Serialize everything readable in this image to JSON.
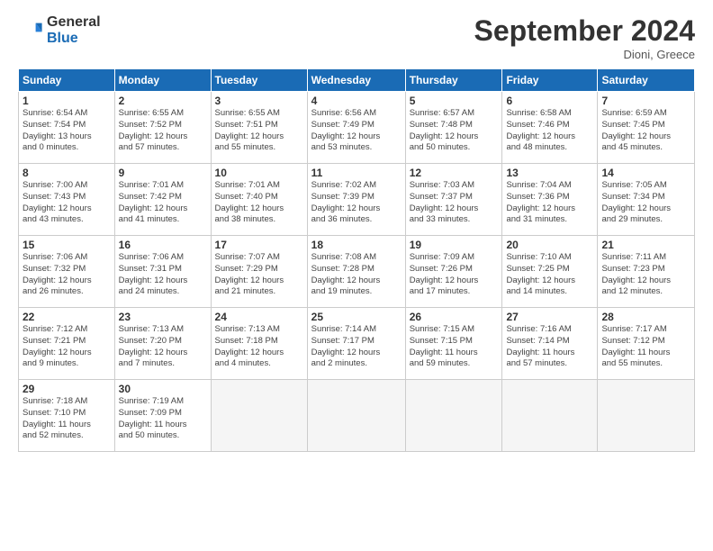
{
  "header": {
    "logo_general": "General",
    "logo_blue": "Blue",
    "title": "September 2024",
    "location": "Dioni, Greece"
  },
  "days_of_week": [
    "Sunday",
    "Monday",
    "Tuesday",
    "Wednesday",
    "Thursday",
    "Friday",
    "Saturday"
  ],
  "weeks": [
    [
      {
        "day": "1",
        "info": "Sunrise: 6:54 AM\nSunset: 7:54 PM\nDaylight: 13 hours\nand 0 minutes."
      },
      {
        "day": "2",
        "info": "Sunrise: 6:55 AM\nSunset: 7:52 PM\nDaylight: 12 hours\nand 57 minutes."
      },
      {
        "day": "3",
        "info": "Sunrise: 6:55 AM\nSunset: 7:51 PM\nDaylight: 12 hours\nand 55 minutes."
      },
      {
        "day": "4",
        "info": "Sunrise: 6:56 AM\nSunset: 7:49 PM\nDaylight: 12 hours\nand 53 minutes."
      },
      {
        "day": "5",
        "info": "Sunrise: 6:57 AM\nSunset: 7:48 PM\nDaylight: 12 hours\nand 50 minutes."
      },
      {
        "day": "6",
        "info": "Sunrise: 6:58 AM\nSunset: 7:46 PM\nDaylight: 12 hours\nand 48 minutes."
      },
      {
        "day": "7",
        "info": "Sunrise: 6:59 AM\nSunset: 7:45 PM\nDaylight: 12 hours\nand 45 minutes."
      }
    ],
    [
      {
        "day": "8",
        "info": "Sunrise: 7:00 AM\nSunset: 7:43 PM\nDaylight: 12 hours\nand 43 minutes."
      },
      {
        "day": "9",
        "info": "Sunrise: 7:01 AM\nSunset: 7:42 PM\nDaylight: 12 hours\nand 41 minutes."
      },
      {
        "day": "10",
        "info": "Sunrise: 7:01 AM\nSunset: 7:40 PM\nDaylight: 12 hours\nand 38 minutes."
      },
      {
        "day": "11",
        "info": "Sunrise: 7:02 AM\nSunset: 7:39 PM\nDaylight: 12 hours\nand 36 minutes."
      },
      {
        "day": "12",
        "info": "Sunrise: 7:03 AM\nSunset: 7:37 PM\nDaylight: 12 hours\nand 33 minutes."
      },
      {
        "day": "13",
        "info": "Sunrise: 7:04 AM\nSunset: 7:36 PM\nDaylight: 12 hours\nand 31 minutes."
      },
      {
        "day": "14",
        "info": "Sunrise: 7:05 AM\nSunset: 7:34 PM\nDaylight: 12 hours\nand 29 minutes."
      }
    ],
    [
      {
        "day": "15",
        "info": "Sunrise: 7:06 AM\nSunset: 7:32 PM\nDaylight: 12 hours\nand 26 minutes."
      },
      {
        "day": "16",
        "info": "Sunrise: 7:06 AM\nSunset: 7:31 PM\nDaylight: 12 hours\nand 24 minutes."
      },
      {
        "day": "17",
        "info": "Sunrise: 7:07 AM\nSunset: 7:29 PM\nDaylight: 12 hours\nand 21 minutes."
      },
      {
        "day": "18",
        "info": "Sunrise: 7:08 AM\nSunset: 7:28 PM\nDaylight: 12 hours\nand 19 minutes."
      },
      {
        "day": "19",
        "info": "Sunrise: 7:09 AM\nSunset: 7:26 PM\nDaylight: 12 hours\nand 17 minutes."
      },
      {
        "day": "20",
        "info": "Sunrise: 7:10 AM\nSunset: 7:25 PM\nDaylight: 12 hours\nand 14 minutes."
      },
      {
        "day": "21",
        "info": "Sunrise: 7:11 AM\nSunset: 7:23 PM\nDaylight: 12 hours\nand 12 minutes."
      }
    ],
    [
      {
        "day": "22",
        "info": "Sunrise: 7:12 AM\nSunset: 7:21 PM\nDaylight: 12 hours\nand 9 minutes."
      },
      {
        "day": "23",
        "info": "Sunrise: 7:13 AM\nSunset: 7:20 PM\nDaylight: 12 hours\nand 7 minutes."
      },
      {
        "day": "24",
        "info": "Sunrise: 7:13 AM\nSunset: 7:18 PM\nDaylight: 12 hours\nand 4 minutes."
      },
      {
        "day": "25",
        "info": "Sunrise: 7:14 AM\nSunset: 7:17 PM\nDaylight: 12 hours\nand 2 minutes."
      },
      {
        "day": "26",
        "info": "Sunrise: 7:15 AM\nSunset: 7:15 PM\nDaylight: 11 hours\nand 59 minutes."
      },
      {
        "day": "27",
        "info": "Sunrise: 7:16 AM\nSunset: 7:14 PM\nDaylight: 11 hours\nand 57 minutes."
      },
      {
        "day": "28",
        "info": "Sunrise: 7:17 AM\nSunset: 7:12 PM\nDaylight: 11 hours\nand 55 minutes."
      }
    ],
    [
      {
        "day": "29",
        "info": "Sunrise: 7:18 AM\nSunset: 7:10 PM\nDaylight: 11 hours\nand 52 minutes."
      },
      {
        "day": "30",
        "info": "Sunrise: 7:19 AM\nSunset: 7:09 PM\nDaylight: 11 hours\nand 50 minutes."
      },
      {
        "day": "",
        "info": ""
      },
      {
        "day": "",
        "info": ""
      },
      {
        "day": "",
        "info": ""
      },
      {
        "day": "",
        "info": ""
      },
      {
        "day": "",
        "info": ""
      }
    ]
  ]
}
